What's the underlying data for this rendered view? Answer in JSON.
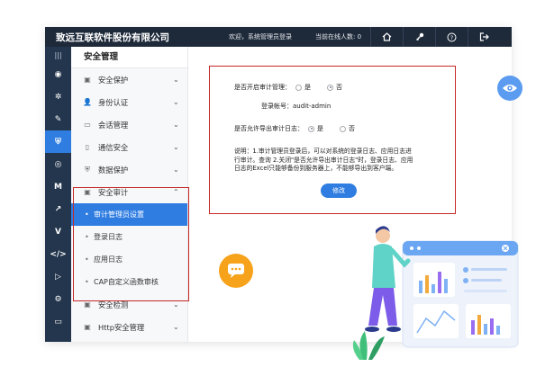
{
  "header": {
    "title": "致远互联软件股份有限公司",
    "welcome": "欢迎，系统管理员登录",
    "online": "当前在线人数: 0",
    "icons": [
      "home-icon",
      "key-icon",
      "help-icon",
      "logout-icon"
    ]
  },
  "rail": {
    "items": [
      "menu-icon",
      "dashboard-icon",
      "settings-icon",
      "pin-icon",
      "shield-icon",
      "circle-icon",
      "m-icon",
      "arrow-icon",
      "v-icon",
      "code-icon",
      "play-icon",
      "gear-icon",
      "monitor-icon"
    ]
  },
  "sidebar": {
    "heading": "安全管理",
    "items_top": [
      {
        "label": "安全保护",
        "arrow": "⌄"
      },
      {
        "label": "身份认证",
        "arrow": "⌄"
      },
      {
        "label": "会话管理",
        "arrow": "⌄"
      },
      {
        "label": "通信安全",
        "arrow": "⌄"
      },
      {
        "label": "数据保护",
        "arrow": "⌄"
      }
    ],
    "audit": {
      "label": "安全审计",
      "arrow": "⌃"
    },
    "audit_children": [
      {
        "label": "审计管理员设置"
      },
      {
        "label": "登录日志"
      },
      {
        "label": "应用日志"
      },
      {
        "label": "CAP自定义函数审核"
      }
    ],
    "items_bottom": [
      {
        "label": "安全检测",
        "arrow": "⌄"
      },
      {
        "label": "Http安全管理",
        "arrow": "⌄"
      }
    ]
  },
  "settings": {
    "enable_label": "是否开启审计管理：",
    "opt_yes": "是",
    "opt_no": "否",
    "account_label": "登录帐号：",
    "account_value": "audit-admin",
    "export_label": "是否允许导出审计日志：",
    "note_line1": "说明：1.审计管理员登录后，可以对系统的登录日志、应用日志进",
    "note_line2": "行审计。查询 2.关闭\"是否允许导出审计日志\"时，登录日志、应用",
    "note_line3": "日志的Excel只能够备份到服务器上，不能够导出到客户端。",
    "modify_button": "修改"
  },
  "colors": {
    "topbar": "#1e2a3a",
    "rail": "#24364d",
    "accent": "#2f7de1",
    "highlight_border": "#c62828",
    "chat_badge": "#f7a21b"
  }
}
